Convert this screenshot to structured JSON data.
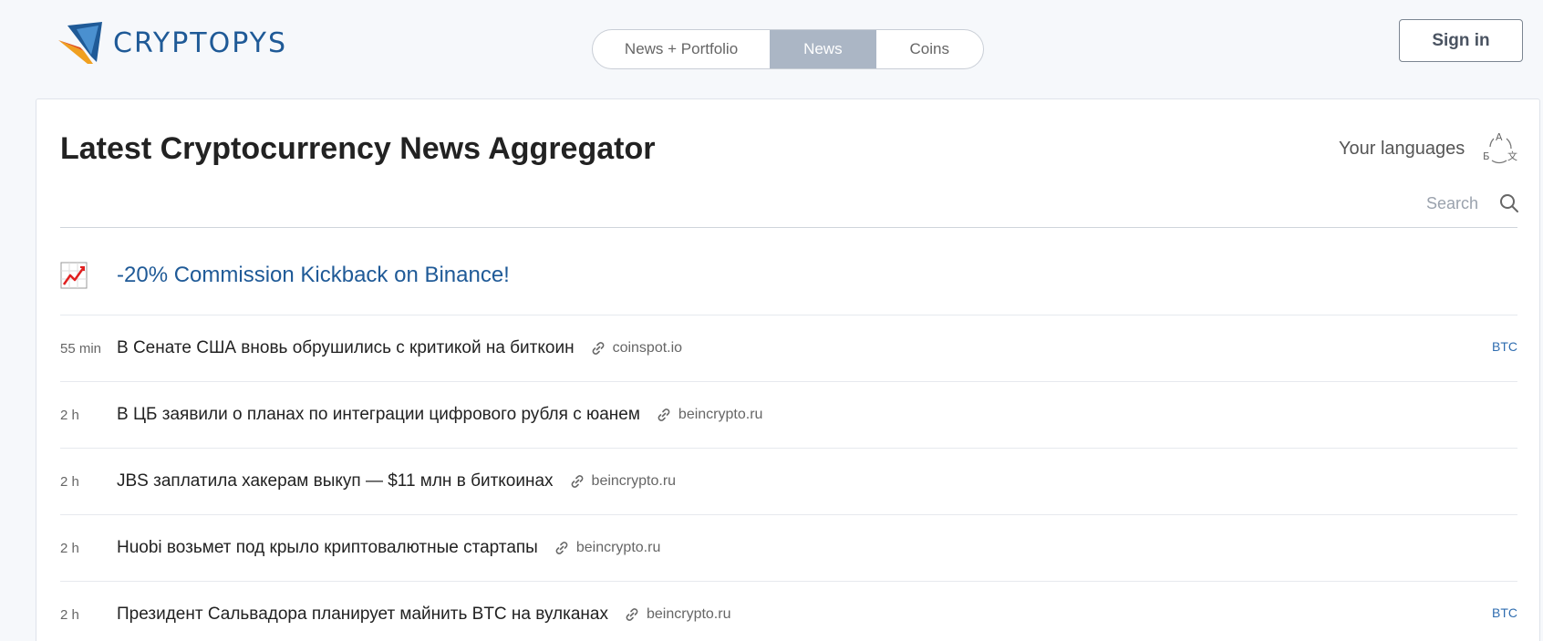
{
  "header": {
    "logo_text": "CRYPTOPYS",
    "tabs": [
      {
        "label": "News + Portfolio"
      },
      {
        "label": "News"
      },
      {
        "label": "Coins"
      }
    ],
    "sign_in_label": "Sign in"
  },
  "main": {
    "title": "Latest Cryptocurrency News Aggregator",
    "languages_label": "Your languages",
    "search_placeholder": "Search",
    "promo": {
      "icon": "chart-up-icon",
      "text": "-20% Commission Kickback on Binance!"
    },
    "news": [
      {
        "time": "55 min",
        "title": "В Сенате США вновь обрушились с критикой на биткоин",
        "source": "coinspot.io",
        "tag": "BTC"
      },
      {
        "time": "2 h",
        "title": "В ЦБ заявили о планах по интеграции цифрового рубля с юанем",
        "source": "beincrypto.ru",
        "tag": ""
      },
      {
        "time": "2 h",
        "title": "JBS заплатила хакерам выкуп — $11 млн в биткоинах",
        "source": "beincrypto.ru",
        "tag": ""
      },
      {
        "time": "2 h",
        "title": "Huobi возьмет под крыло криптовалютные стартапы",
        "source": "beincrypto.ru",
        "tag": ""
      },
      {
        "time": "2 h",
        "title": "Президент Сальвадора планирует майнить BTC на вулканах",
        "source": "beincrypto.ru",
        "tag": "BTC"
      }
    ]
  },
  "colors": {
    "accent": "#1f5a97",
    "active_tab": "#abb6c5",
    "tag": "#2f6db0",
    "background": "#f6f8fb"
  }
}
